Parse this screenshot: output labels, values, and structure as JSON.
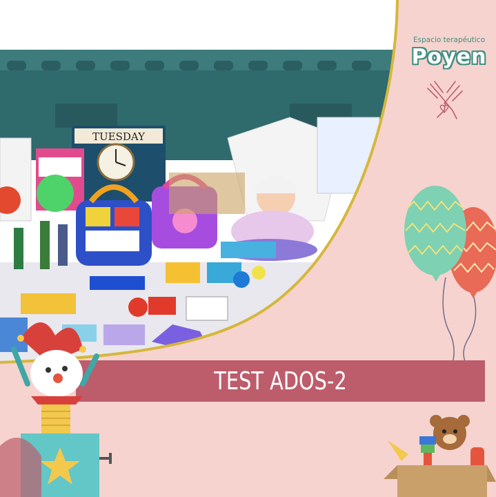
{
  "brand": {
    "subtitle": "Espacio terapéutico",
    "name": "Poyen"
  },
  "banner": {
    "title": "TEST ADOS-2"
  },
  "photo": {
    "clock_label": "TUESDAY"
  },
  "colors": {
    "background": "#f6d3ce",
    "banner": "#bd5d6c",
    "frame_line": "#d5b73c",
    "brand_teal": "#3f8f83",
    "bin_teal": "#2f6a6d"
  }
}
